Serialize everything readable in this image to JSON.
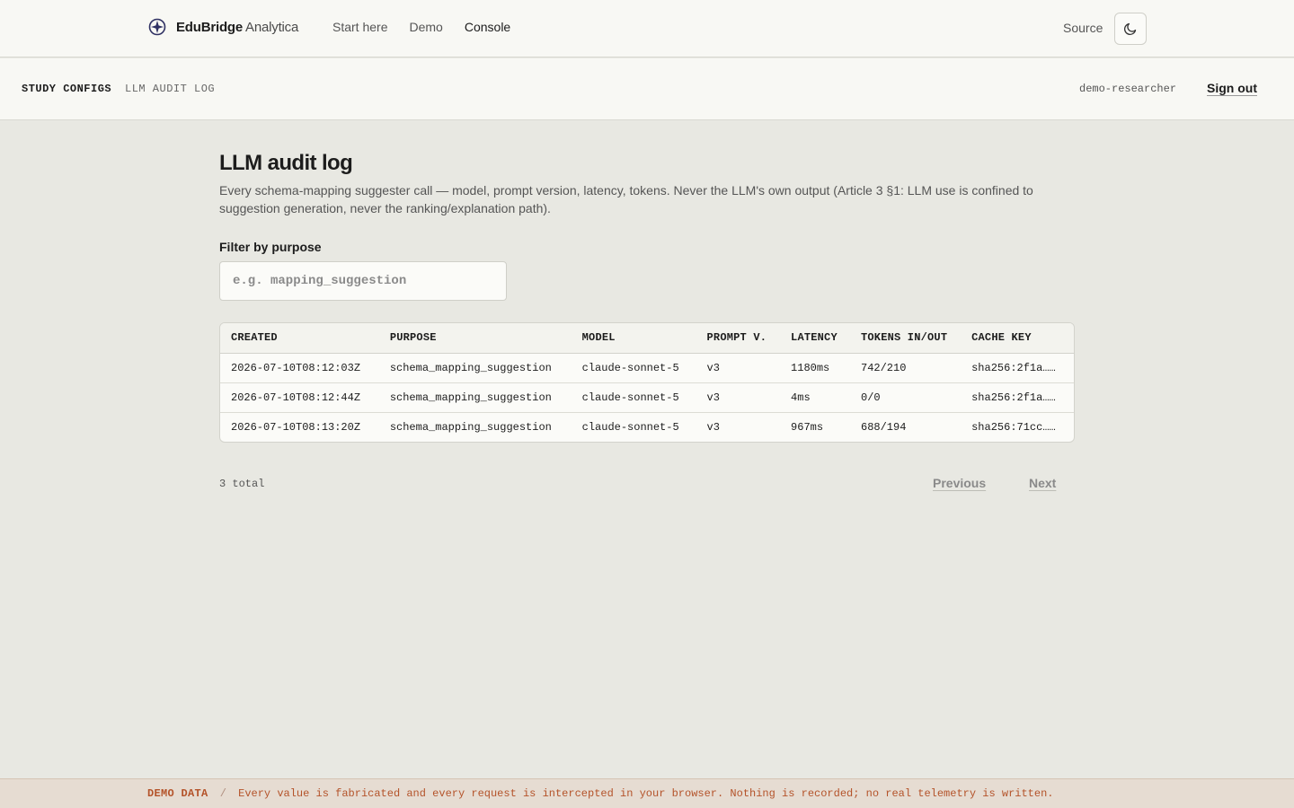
{
  "brand": {
    "name": "EduBridge",
    "sub": "Analytica"
  },
  "nav": {
    "items": [
      {
        "label": "Start here"
      },
      {
        "label": "Demo"
      },
      {
        "label": "Console"
      }
    ],
    "source_label": "Source"
  },
  "subnav": {
    "tab_study": "STUDY CONFIGS",
    "tab_audit": "LLM AUDIT LOG",
    "user": "demo-researcher",
    "signout": "Sign out"
  },
  "page": {
    "title": "LLM audit log",
    "description": "Every schema-mapping suggester call — model, prompt version, latency, tokens. Never the LLM's own output (Article 3 §1: LLM use is confined to suggestion generation, never the ranking/explanation path).",
    "filter_label": "Filter by purpose",
    "filter_placeholder": "e.g. mapping_suggestion",
    "filter_value": ""
  },
  "table": {
    "headers": [
      "CREATED",
      "PURPOSE",
      "MODEL",
      "PROMPT V.",
      "LATENCY",
      "TOKENS IN/OUT",
      "CACHE KEY"
    ],
    "rows": [
      [
        "2026-07-10T08:12:03Z",
        "schema_mapping_suggestion",
        "claude-sonnet-5",
        "v3",
        "1180ms",
        "742/210",
        "sha256:2f1a……"
      ],
      [
        "2026-07-10T08:12:44Z",
        "schema_mapping_suggestion",
        "claude-sonnet-5",
        "v3",
        "4ms",
        "0/0",
        "sha256:2f1a……"
      ],
      [
        "2026-07-10T08:13:20Z",
        "schema_mapping_suggestion",
        "claude-sonnet-5",
        "v3",
        "967ms",
        "688/194",
        "sha256:71cc……"
      ]
    ]
  },
  "pagination": {
    "total": "3 total",
    "previous": "Previous",
    "next": "Next"
  },
  "banner": {
    "tag": "DEMO DATA",
    "separator": "/",
    "text": "Every value is fabricated and every request is intercepted in your browser. Nothing is recorded; no real telemetry is written."
  },
  "colors": {
    "accent": "#b4532a",
    "logo": "#2f3163"
  }
}
